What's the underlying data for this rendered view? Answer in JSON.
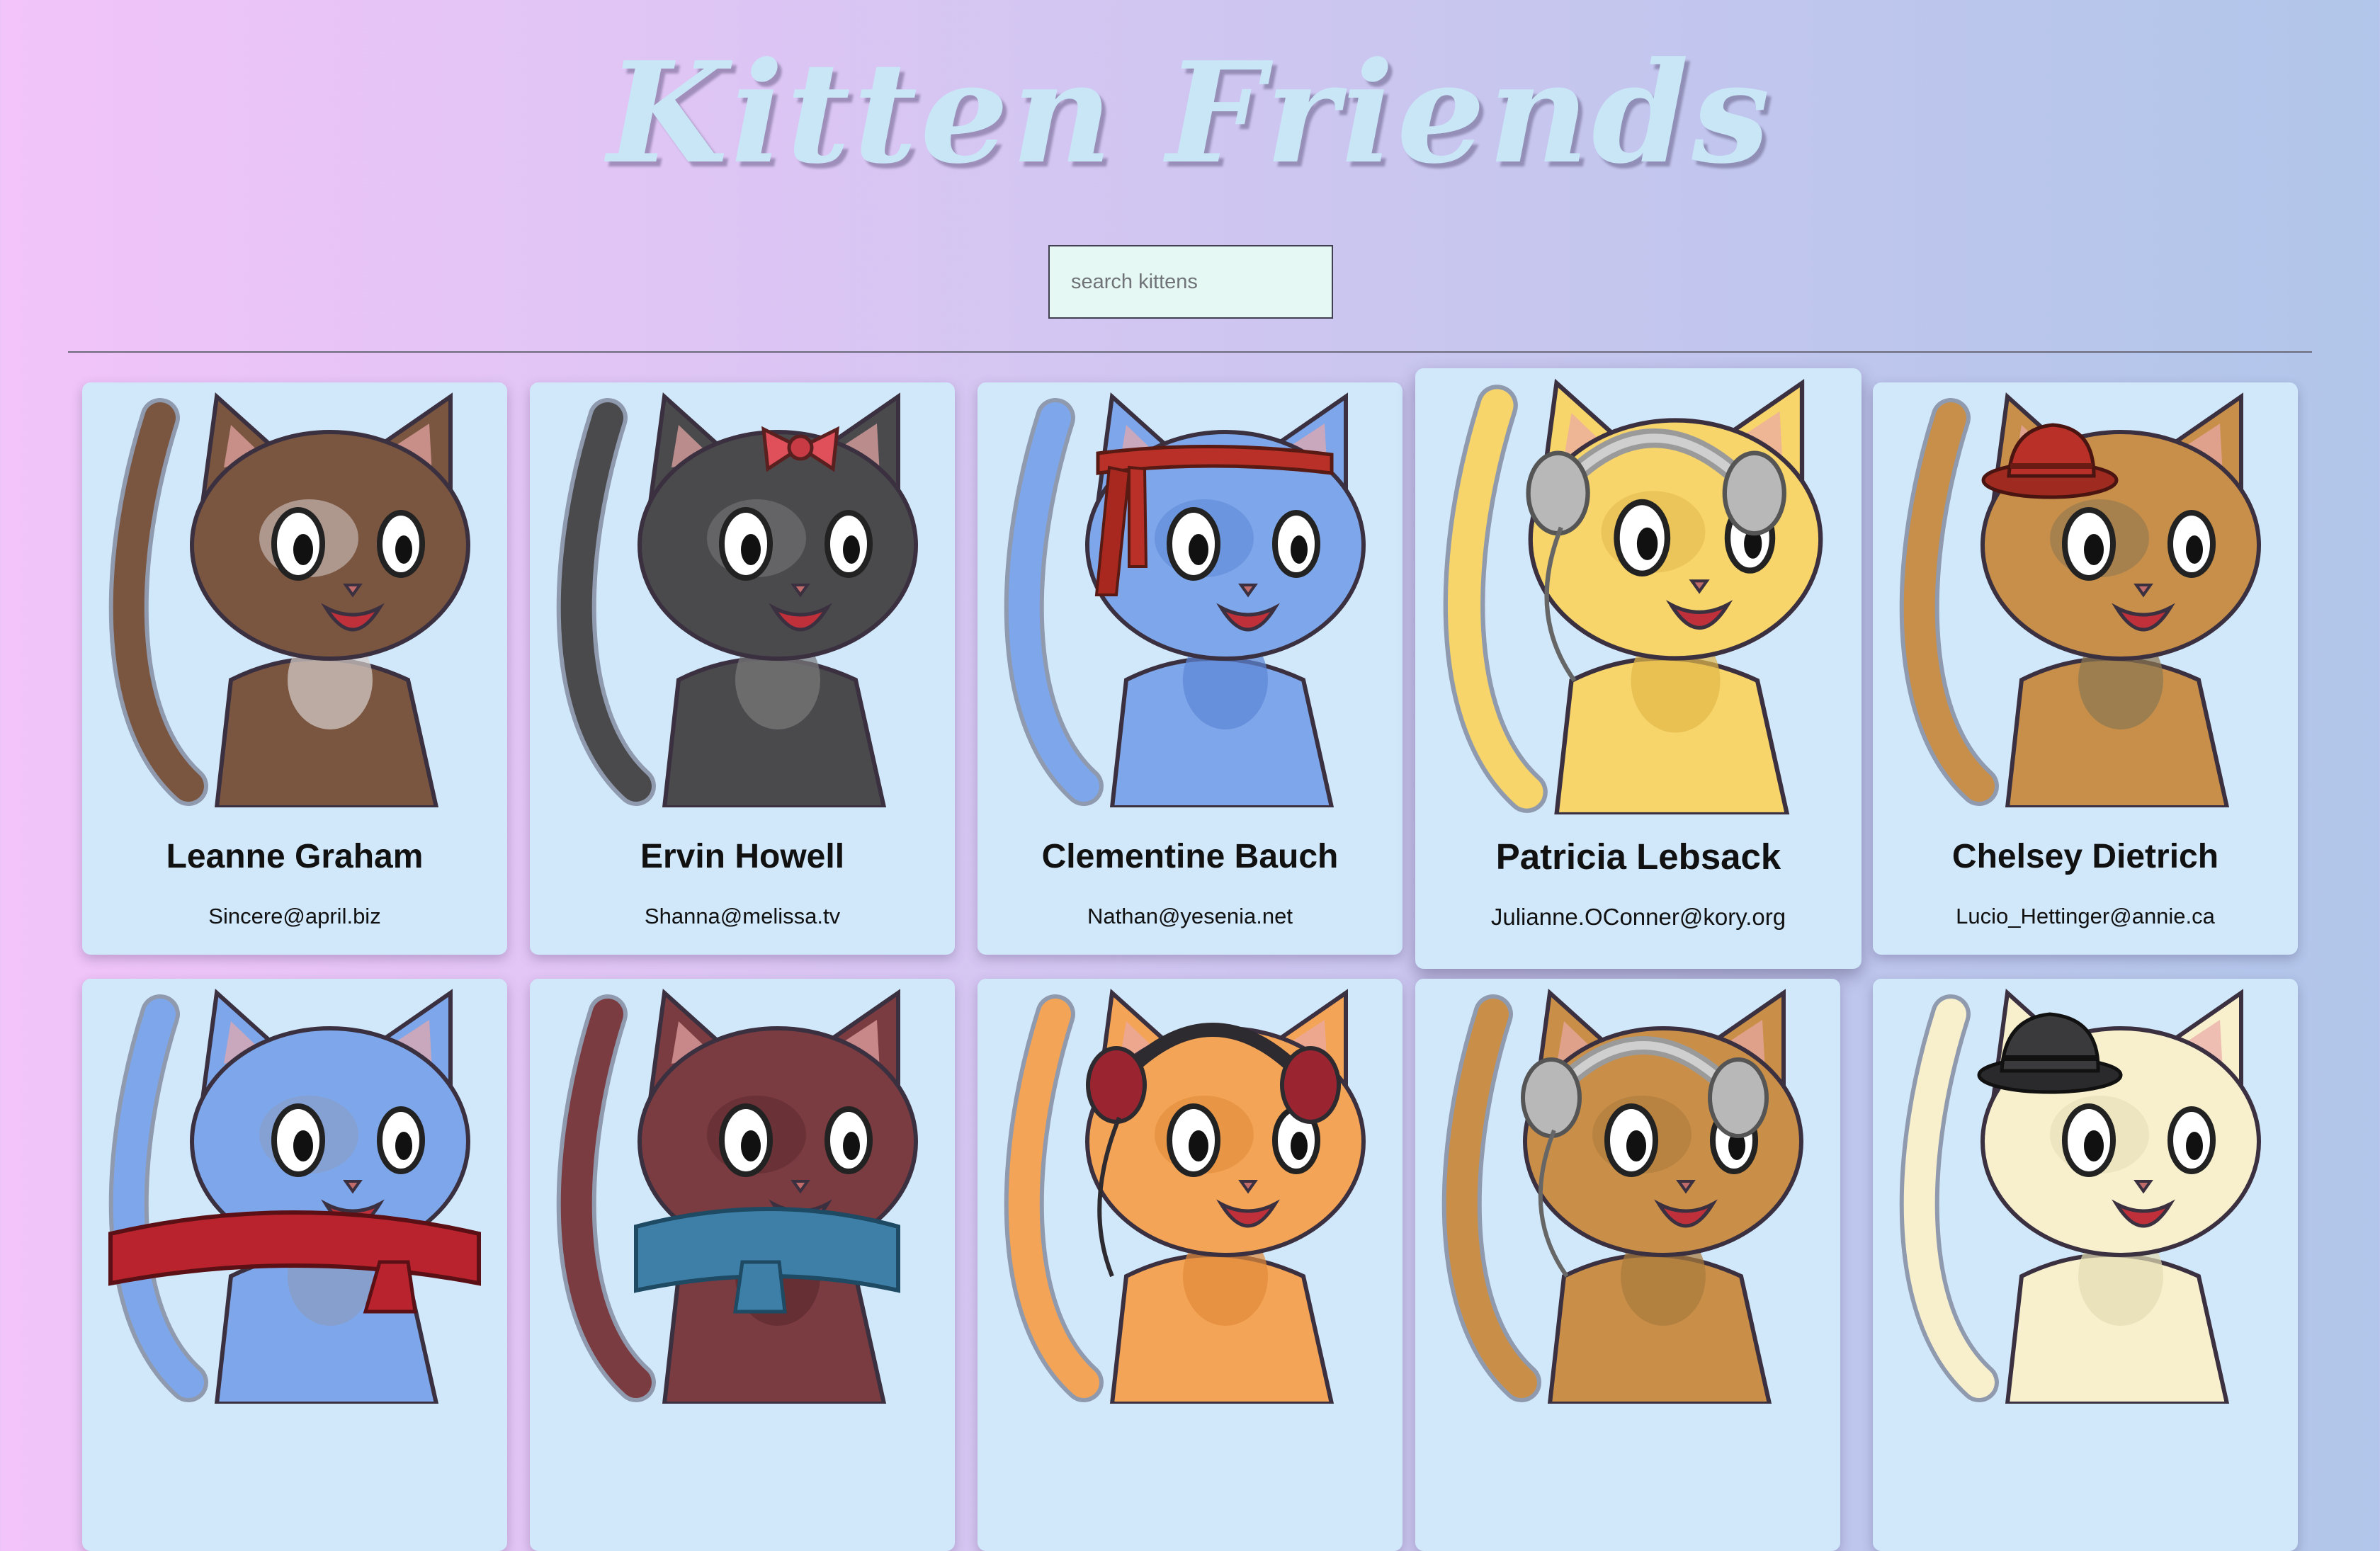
{
  "app": {
    "title": "Kitten Friends"
  },
  "search": {
    "placeholder": "search kittens",
    "value": ""
  },
  "kittens": [
    {
      "name": "Leanne Graham",
      "email": "Sincere@april.biz",
      "fur": "#7a5540",
      "accent": "#d9d0cc",
      "accessory": "none"
    },
    {
      "name": "Ervin Howell",
      "email": "Shanna@melissa.tv",
      "fur": "#4a4a4c",
      "accent": "#7a7a7c",
      "accessory": "bow"
    },
    {
      "name": "Clementine Bauch",
      "email": "Nathan@yesenia.net",
      "fur": "#7ea6ea",
      "accent": "#5c86d6",
      "accessory": "headband"
    },
    {
      "name": "Patricia Lebsack",
      "email": "Julianne.OConner@kory.org",
      "fur": "#f7d56a",
      "accent": "#e2b84a",
      "accessory": "headphones"
    },
    {
      "name": "Chelsey Dietrich",
      "email": "Lucio_Hettinger@annie.ca",
      "fur": "#c78f4a",
      "accent": "#8c7650",
      "accessory": "red-hat"
    },
    {
      "name": "",
      "email": "",
      "fur": "#7ea6ea",
      "accent": "#8a9cc0",
      "accessory": "scarf"
    },
    {
      "name": "",
      "email": "",
      "fur": "#7a3c40",
      "accent": "#5d2a2e",
      "accessory": "blue-scarf"
    },
    {
      "name": "",
      "email": "",
      "fur": "#f4a456",
      "accent": "#df8a3a",
      "accessory": "red-headphones"
    },
    {
      "name": "",
      "email": "",
      "fur": "#c98f48",
      "accent": "#a97a3c",
      "accessory": "headphones"
    },
    {
      "name": "",
      "email": "",
      "fur": "#f8f0cc",
      "accent": "#e4dcb4",
      "accessory": "black-hat"
    }
  ]
}
